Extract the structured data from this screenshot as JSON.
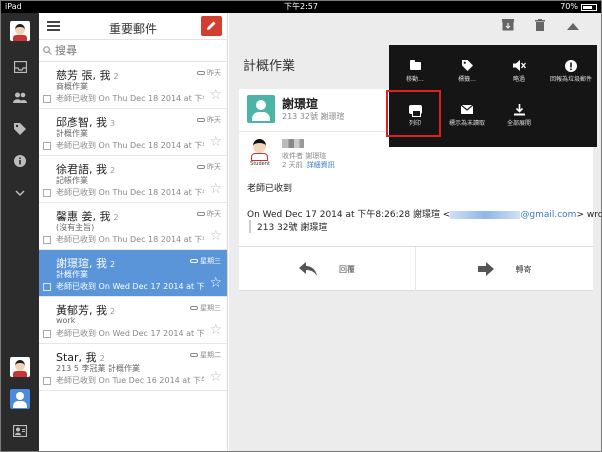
{
  "status_bar": {
    "device": "iPad",
    "time": "下午2:57",
    "battery": "70%"
  },
  "list": {
    "title": "重要郵件",
    "search_placeholder": "搜尋",
    "rows": [
      {
        "sender": "慈芳 張, 我",
        "count": "2",
        "date": "昨天",
        "subject": "商概作業",
        "snippet": "老師已收到 On Thu Dec 18 2014 at 下午1:",
        "selected": false
      },
      {
        "sender": "邱彥智, 我",
        "count": "3",
        "date": "昨天",
        "subject": "計概作業",
        "snippet": "老師已收到 On Thu Dec 18 2014 at 下午1:",
        "selected": false
      },
      {
        "sender": "徐君語, 我",
        "count": "2",
        "date": "昨天",
        "subject": "記帳作業",
        "snippet": "老師已收到 On Thu Dec 18 2014 at 下午9:",
        "selected": false
      },
      {
        "sender": "馨惠 姜, 我",
        "count": "2",
        "date": "昨天",
        "subject": "(沒有主旨)",
        "snippet": "老師已收到 On Thu Dec 18 2014 at 下午9:",
        "selected": false
      },
      {
        "sender": "謝璟瑄, 我",
        "count": "2",
        "date": "星期三",
        "subject": "計概作業",
        "snippet": "老師已收到 On Wed Dec 17 2014 at 下午8:",
        "selected": true
      },
      {
        "sender": "黃郁芳, 我",
        "count": "2",
        "date": "星期三",
        "subject": "work",
        "snippet": "老師已收到 On Wed Dec 17 2014 at 下午1:",
        "selected": false
      },
      {
        "sender": "Star, 我",
        "count": "2",
        "date": "星期二",
        "subject": "213 5 李冠業 計概作業",
        "snippet": "老師已收到 On Tue Dec 16 2014 at 下午1:",
        "selected": false
      }
    ]
  },
  "message": {
    "title": "計概作業",
    "sender": "謝璟瑄",
    "sender_sub": "213 32號 謝璟瑄",
    "recipient_line": "收件者 謝璟瑄",
    "time": "2 天前",
    "details_link": "詳細資訊",
    "avatar_label": "Student",
    "body": "老師已收到",
    "quote_prefix": "On Wed Dec 17 2014 at 下午8:26:28 謝璟瑄 <",
    "quote_email_domain": "@gmail.com",
    "quote_suffix": "> wrote:",
    "quote_text": "213 32號 謝璟瑄",
    "reply_label": "回覆",
    "forward_label": "轉寄"
  },
  "menu": {
    "items": [
      {
        "label": "移動...",
        "icon": "folder-icon"
      },
      {
        "label": "標籤...",
        "icon": "label-icon"
      },
      {
        "label": "略過",
        "icon": "mute-icon"
      },
      {
        "label": "回報為垃圾郵件",
        "icon": "spam-icon"
      },
      {
        "label": "列印",
        "icon": "print-icon"
      },
      {
        "label": "標示為未讀取",
        "icon": "mail-icon"
      },
      {
        "label": "全部展開",
        "icon": "expand-all-icon"
      }
    ]
  },
  "colors": {
    "compose": "#d23f31",
    "selected_row": "#5a94d9",
    "highlight": "#e02020",
    "link": "#3b78c4"
  }
}
